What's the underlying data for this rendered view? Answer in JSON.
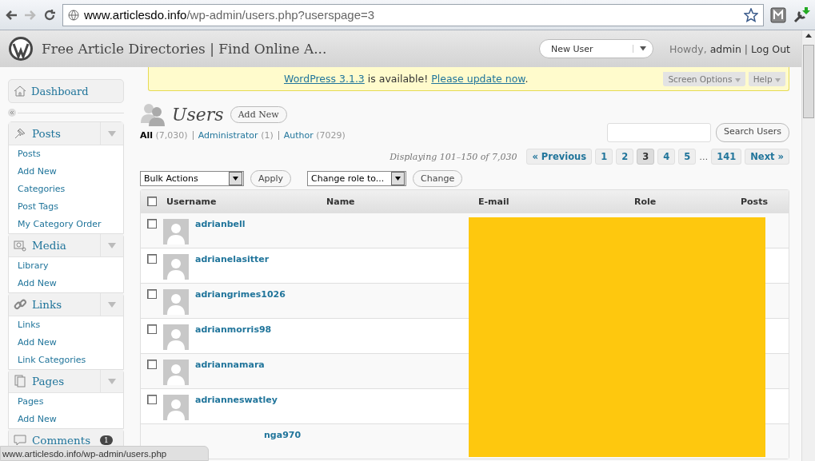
{
  "browser": {
    "url_host": "www.articlesdo.info",
    "url_path": "/wp-admin/users.php?userspage=3",
    "status_url": "www.articlesdo.info/wp-admin/users.php"
  },
  "header": {
    "site_title": "Free Article Directories | Find Online A...",
    "favorite_action": "New User",
    "howdy": "Howdy,",
    "user": "admin",
    "separator": "|",
    "logout": "Log Out"
  },
  "notice": {
    "version_link": "WordPress 3.1.3",
    "middle": "is available!",
    "update_link": "Please update now",
    "end": "."
  },
  "screen_options": "Screen Options",
  "help": "Help",
  "sidebar": {
    "dashboard": "Dashboard",
    "menus": [
      {
        "kind": "pin",
        "label": "Posts",
        "items": [
          "Posts",
          "Add New",
          "Categories",
          "Post Tags",
          "My Category Order"
        ]
      },
      {
        "kind": "media",
        "label": "Media",
        "items": [
          "Library",
          "Add New"
        ]
      },
      {
        "kind": "link",
        "label": "Links",
        "items": [
          "Links",
          "Add New",
          "Link Categories"
        ]
      },
      {
        "kind": "pages",
        "label": "Pages",
        "items": [
          "Pages",
          "Add New"
        ]
      },
      {
        "kind": "comment",
        "label": "Comments",
        "badge": "1"
      }
    ]
  },
  "page": {
    "title": "Users",
    "add_new": "Add New",
    "filters": [
      {
        "label": "All",
        "count": "(7,030)",
        "selected": true
      },
      {
        "label": "Administrator",
        "count": "(1)",
        "selected": false
      },
      {
        "label": "Author",
        "count": "(7029)",
        "selected": false
      }
    ],
    "search_button": "Search Users",
    "displaying": "Displaying 101–150 of 7,030",
    "pagination": [
      {
        "label": "« Previous",
        "selected": false
      },
      {
        "label": "1",
        "selected": false
      },
      {
        "label": "2",
        "selected": false
      },
      {
        "label": "3",
        "selected": true
      },
      {
        "label": "4",
        "selected": false
      },
      {
        "label": "5",
        "selected": false
      },
      {
        "label": "…",
        "kind": "gap"
      },
      {
        "label": "141",
        "selected": false
      },
      {
        "label": "Next »",
        "selected": false
      }
    ],
    "bulk_actions": "Bulk Actions",
    "apply": "Apply",
    "change_role": "Change role to...",
    "change": "Change"
  },
  "table": {
    "select_all_checked": false,
    "columns": [
      "Username",
      "Name",
      "E-mail",
      "Role",
      "Posts"
    ],
    "rows": [
      {
        "username": "adrianbell",
        "checked": false
      },
      {
        "username": "adrianelasitter",
        "checked": false
      },
      {
        "username": "adriangrimes1026",
        "checked": false
      },
      {
        "username": "adrianmorris98",
        "checked": false
      },
      {
        "username": "adriannamara",
        "checked": false
      },
      {
        "username": "adrianneswatley",
        "checked": false
      },
      {
        "username": "nga970",
        "cut_left": true
      }
    ]
  }
}
